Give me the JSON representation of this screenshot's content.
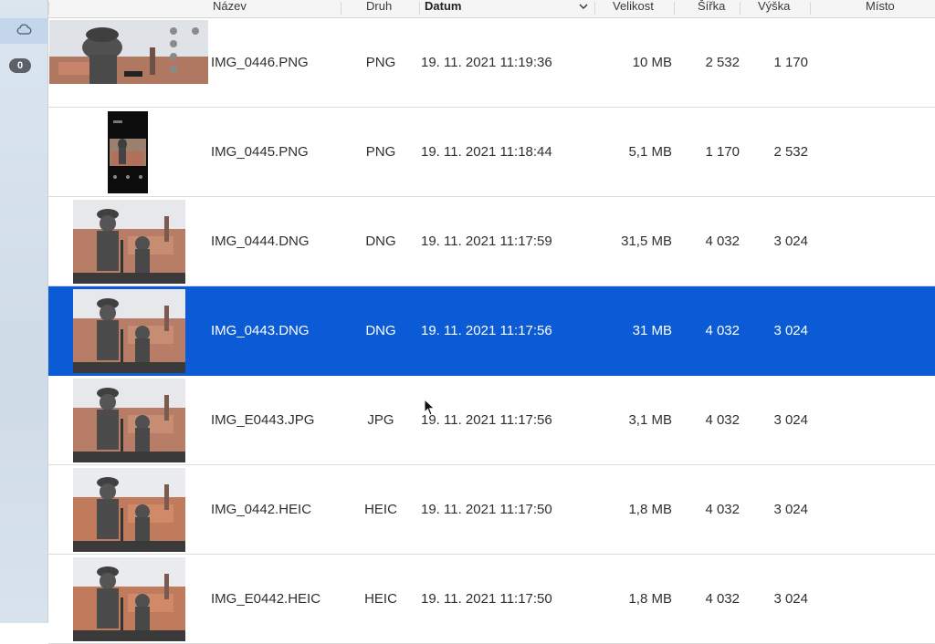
{
  "sidebar": {
    "icon": "cloud-icon",
    "badge": "0"
  },
  "columns": {
    "name": "Název",
    "kind": "Druh",
    "date": "Datum",
    "size": "Velikost",
    "width": "Šířka",
    "height": "Výška",
    "location": "Místo"
  },
  "sort": {
    "column": "Datum",
    "indicator": "chevron-down-icon"
  },
  "rows": [
    {
      "name": "IMG_0446.PNG",
      "kind": "PNG",
      "date": "19. 11. 2021 11:19:36",
      "size": "10 MB",
      "width": "2 532",
      "height": "1 170",
      "selected": false,
      "thumb": "landscape-screenshot"
    },
    {
      "name": "IMG_0445.PNG",
      "kind": "PNG",
      "date": "19. 11. 2021 11:18:44",
      "size": "5,1 MB",
      "width": "1 170",
      "height": "2 532",
      "selected": false,
      "thumb": "portrait-screenshot"
    },
    {
      "name": "IMG_0444.DNG",
      "kind": "DNG",
      "date": "19. 11. 2021 11:17:59",
      "size": "31,5 MB",
      "width": "4 032",
      "height": "3 024",
      "selected": false,
      "thumb": "statue-photo"
    },
    {
      "name": "IMG_0443.DNG",
      "kind": "DNG",
      "date": "19. 11. 2021 11:17:56",
      "size": "31 MB",
      "width": "4 032",
      "height": "3 024",
      "selected": true,
      "thumb": "statue-photo"
    },
    {
      "name": "IMG_E0443.JPG",
      "kind": "JPG",
      "date": "19. 11. 2021 11:17:56",
      "size": "3,1 MB",
      "width": "4 032",
      "height": "3 024",
      "selected": false,
      "thumb": "statue-photo"
    },
    {
      "name": "IMG_0442.HEIC",
      "kind": "HEIC",
      "date": "19. 11. 2021 11:17:50",
      "size": "1,8 MB",
      "width": "4 032",
      "height": "3 024",
      "selected": false,
      "thumb": "statue-photo"
    },
    {
      "name": "IMG_E0442.HEIC",
      "kind": "HEIC",
      "date": "19. 11. 2021 11:17:50",
      "size": "1,8 MB",
      "width": "4 032",
      "height": "3 024",
      "selected": false,
      "thumb": "statue-photo"
    }
  ],
  "colors": {
    "selection": "#0b5bd6",
    "sidebar": "#d4e0eb"
  }
}
